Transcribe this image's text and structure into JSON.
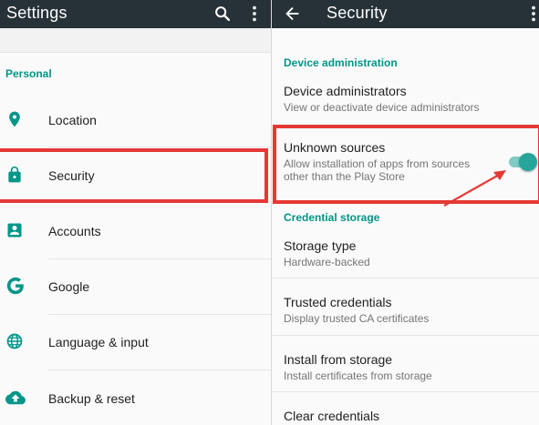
{
  "left": {
    "title": "Settings",
    "section": "Personal",
    "items": [
      {
        "label": "Location"
      },
      {
        "label": "Security"
      },
      {
        "label": "Accounts"
      },
      {
        "label": "Google"
      },
      {
        "label": "Language & input"
      },
      {
        "label": "Backup & reset"
      }
    ]
  },
  "right": {
    "title": "Security",
    "sections": [
      {
        "header": "Device administration",
        "items": [
          {
            "title": "Device administrators",
            "subtitle": "View or deactivate device administrators"
          },
          {
            "title": "Unknown sources",
            "subtitle": "Allow installation of apps from sources other than the Play Store",
            "toggle_on": true
          }
        ]
      },
      {
        "header": "Credential storage",
        "items": [
          {
            "title": "Storage type",
            "subtitle": "Hardware-backed"
          },
          {
            "title": "Trusted credentials",
            "subtitle": "Display trusted CA certificates"
          },
          {
            "title": "Install from storage",
            "subtitle": "Install certificates from storage"
          },
          {
            "title": "Clear credentials",
            "subtitle": ""
          }
        ]
      }
    ]
  },
  "colors": {
    "appbar": "#263238",
    "accent": "#009688",
    "highlight": "#e53935"
  },
  "icons": [
    "search-icon",
    "more-vert-icon",
    "back-arrow-icon",
    "location-icon",
    "lock-icon",
    "account-box-icon",
    "google-icon",
    "globe-icon",
    "cloud-upload-icon"
  ]
}
